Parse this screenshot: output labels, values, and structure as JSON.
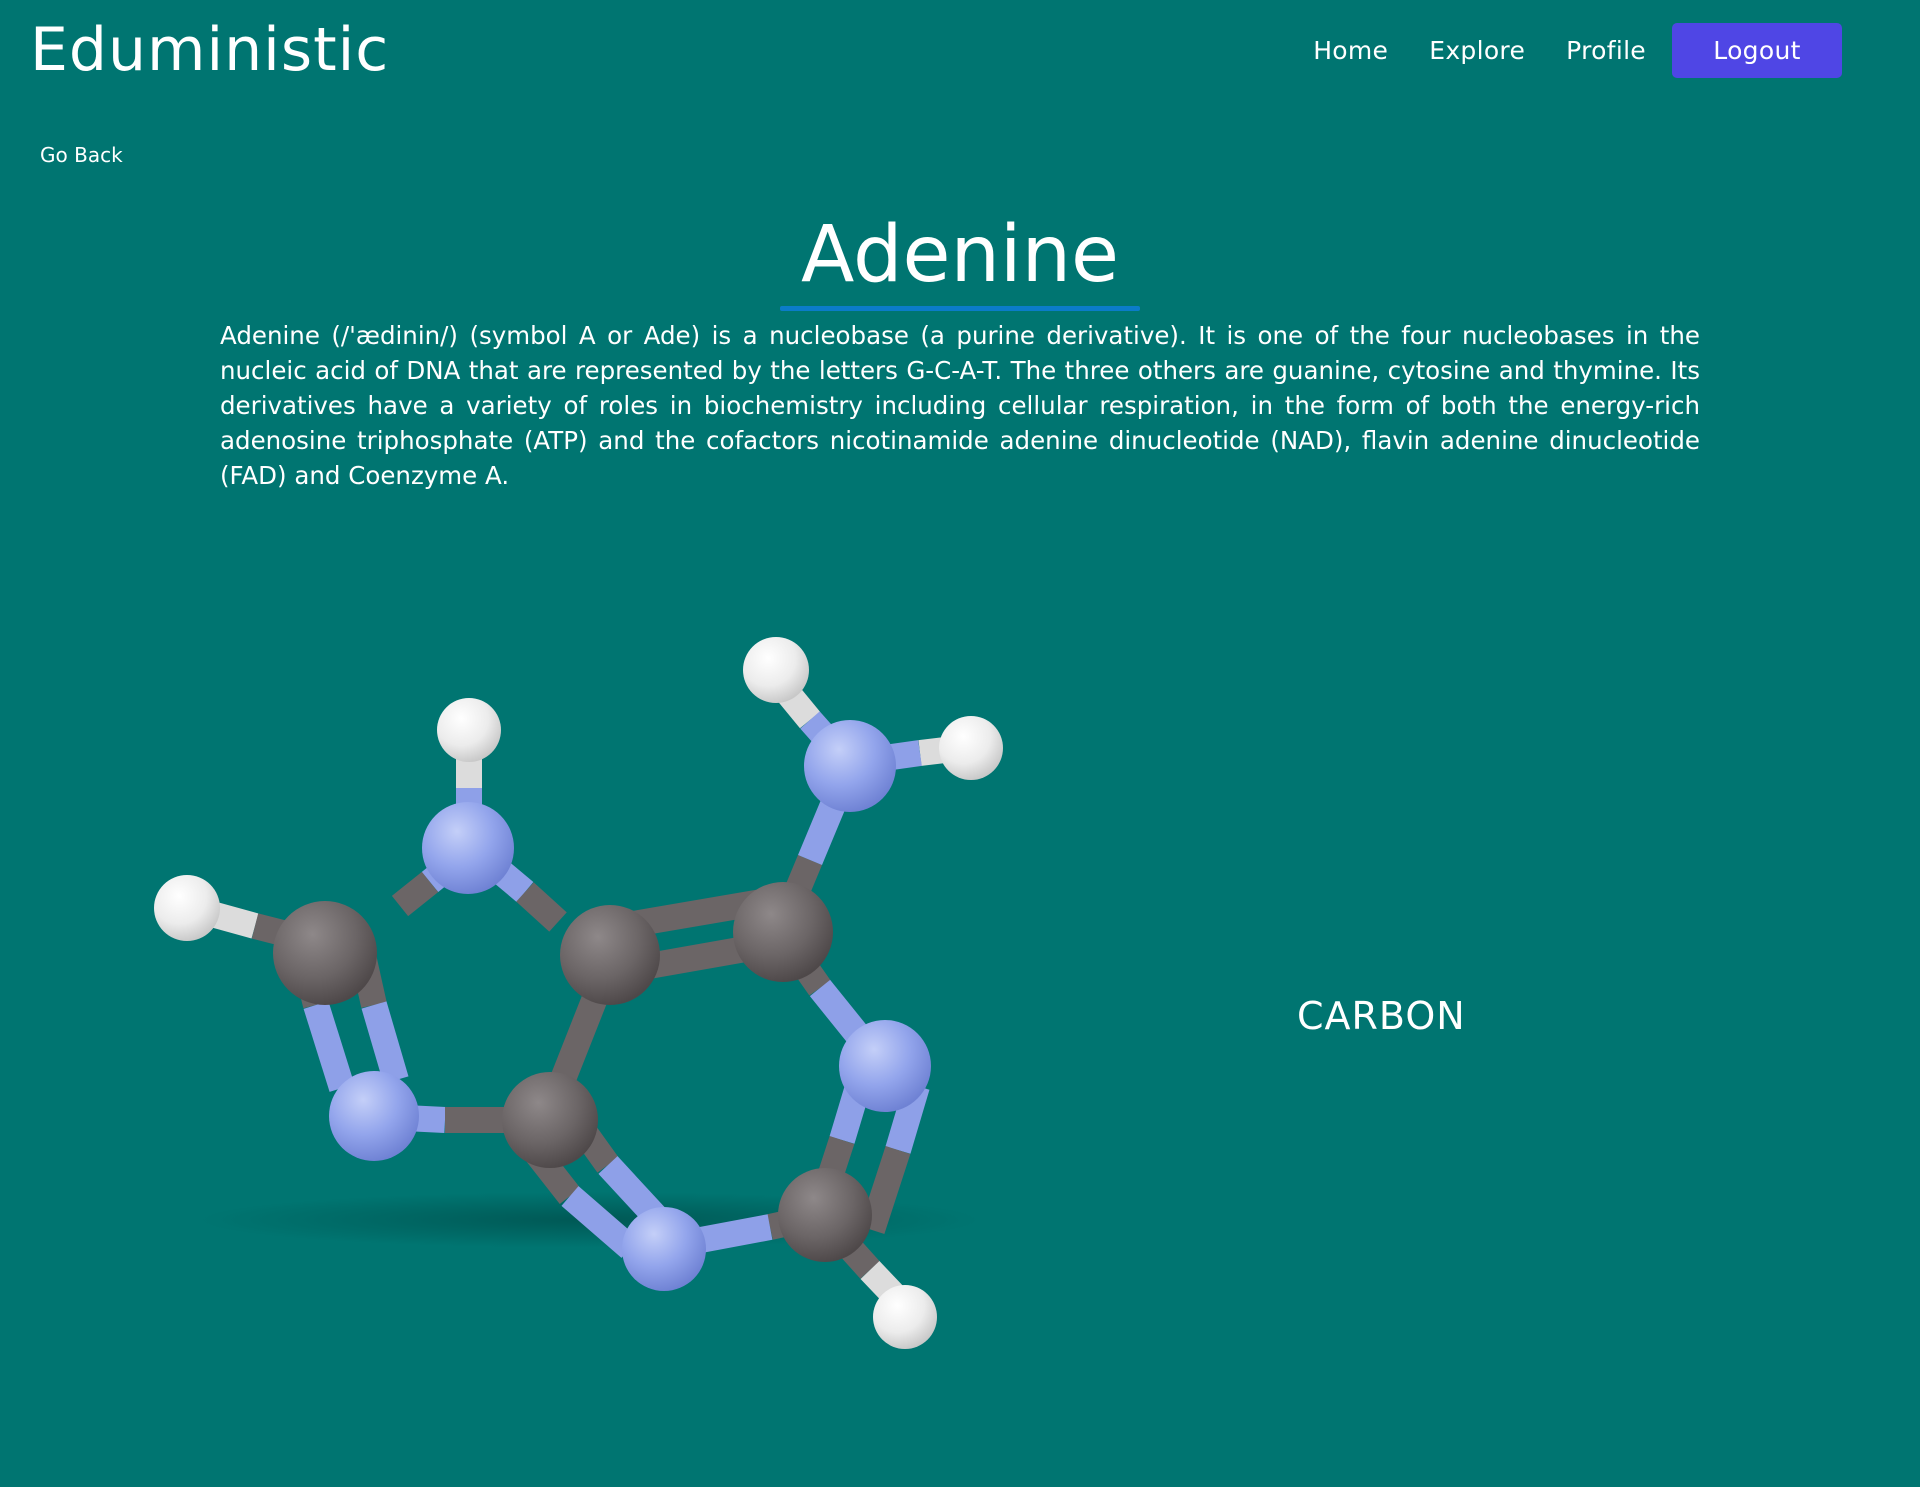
{
  "header": {
    "brand": "Eduministic",
    "nav": {
      "home": "Home",
      "explore": "Explore",
      "profile": "Profile",
      "logout": "Logout"
    }
  },
  "go_back": "Go Back",
  "molecule": {
    "name": "Adenine",
    "description": "Adenine (/'ædinin/) (symbol A or Ade) is a nucleobase (a purine derivative). It is one of the four nucleobases in the nucleic acid of DNA that are represented by the letters G-C-A-T. The three others are guanine, cytosine and thymine. Its derivatives have a variety of roles in biochemistry including cellular respiration, in the form of both the energy-rich adenosine triphosphate (ATP) and the cofactors nicotinamide adenine dinucleotide (NAD), flavin adenine dinucleotide (FAD) and Coenzyme A.",
    "hovered_atom": "CARBON"
  },
  "colors": {
    "background": "#007571",
    "logout_button": "#4f46e5",
    "title_underline": "#0b7cc9",
    "carbon": "#6b6566",
    "nitrogen": "#8ea0e8",
    "hydrogen": "#e8e8e8"
  },
  "icons": {
    "molecule_model": "adenine-3d-model"
  }
}
